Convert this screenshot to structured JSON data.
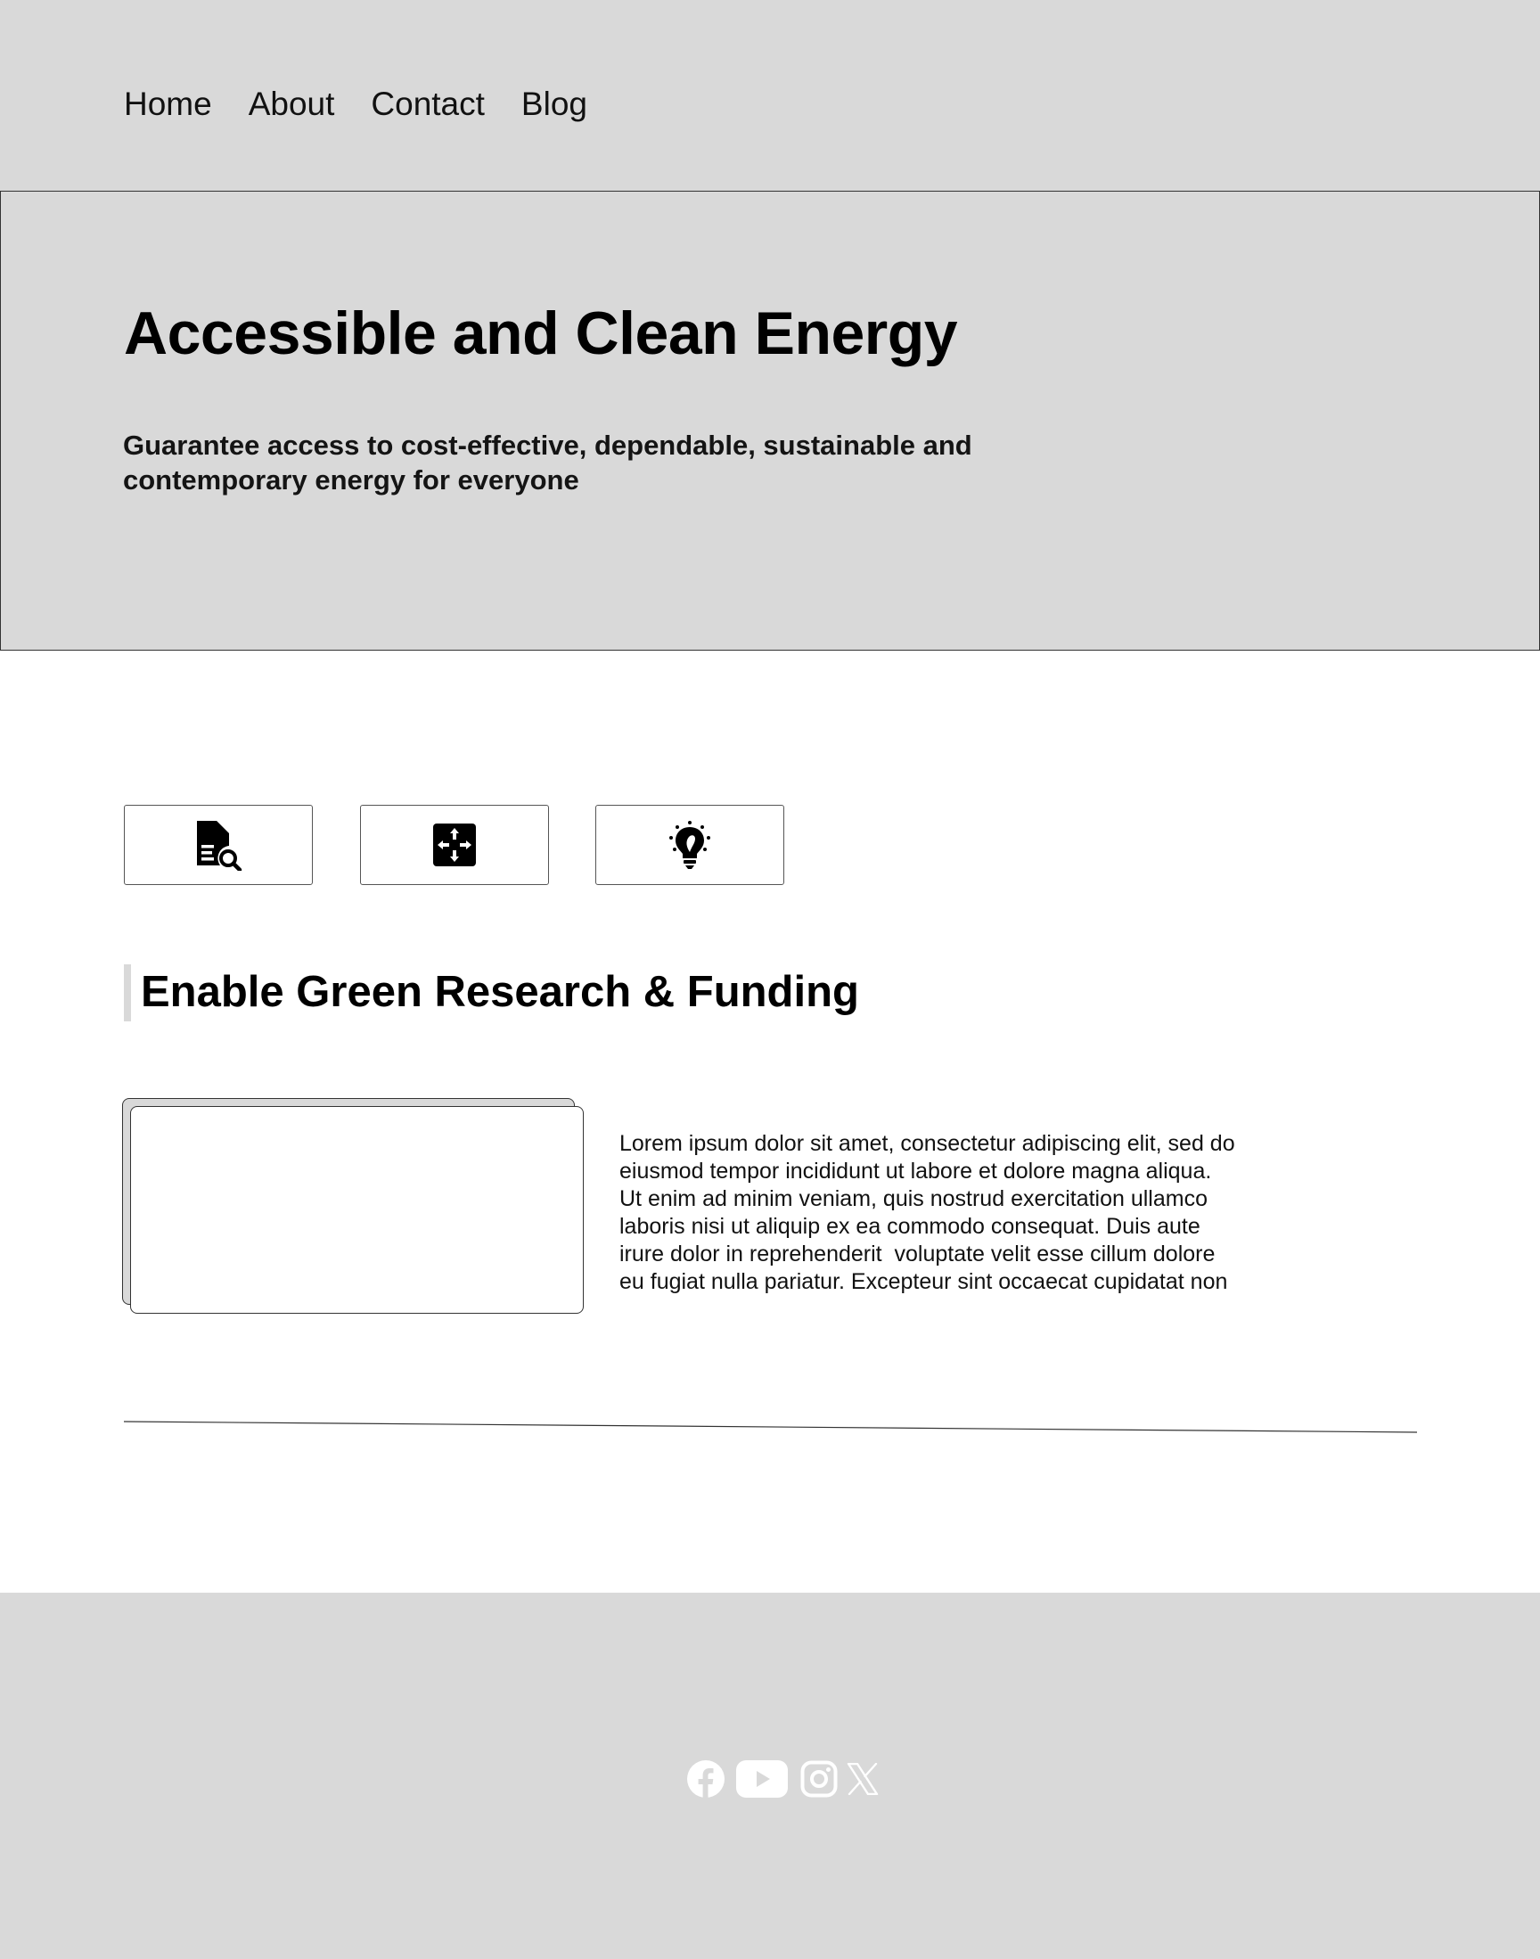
{
  "nav": {
    "items": [
      {
        "label": "Home"
      },
      {
        "label": "About"
      },
      {
        "label": "Contact"
      },
      {
        "label": "Blog"
      }
    ]
  },
  "hero": {
    "title": "Accessible and Clean Energy",
    "subtitle_line1": "Guarantee access to cost-effective, dependable, sustainable and",
    "subtitle_line2": "contemporary energy for everyone",
    "background_color": "#d9d9d9"
  },
  "features": {
    "icons": [
      "document-search-icon",
      "expand-arrows-icon",
      "lightbulb-icon"
    ]
  },
  "section": {
    "heading": "Enable Green Research & Funding",
    "body_lines": [
      "Lorem ipsum dolor sit amet, consectetur adipiscing elit, sed do",
      "eiusmod tempor incididunt ut labore et dolore magna aliqua.",
      "Ut enim ad minim veniam, quis nostrud exercitation ullamco",
      "laboris nisi ut aliquip ex ea commodo consequat. Duis aute",
      "irure dolor in reprehenderit  voluptate velit esse cillum dolore",
      "eu fugiat nulla pariatur. Excepteur sint occaecat cupidatat non"
    ]
  },
  "footer": {
    "social_icons": [
      "facebook-icon",
      "youtube-icon",
      "instagram-icon",
      "x-icon"
    ],
    "background_color": "#d9d9d9"
  }
}
